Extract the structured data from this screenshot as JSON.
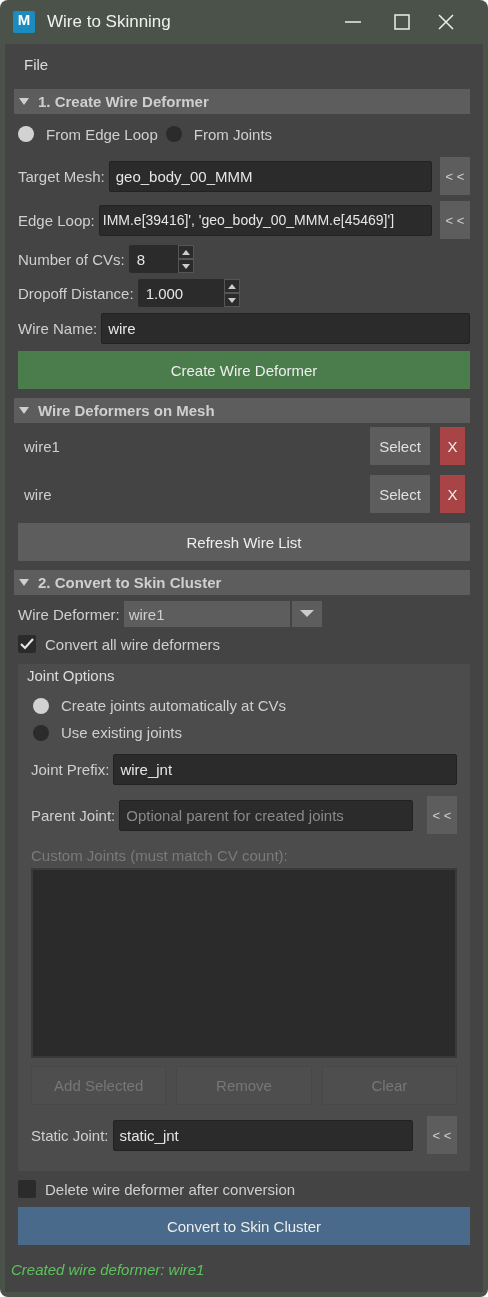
{
  "window": {
    "title": "Wire to Skinning",
    "icon_letter": "M"
  },
  "menu": [
    {
      "label": "File"
    }
  ],
  "create_section": {
    "title": "1. Create Wire Deformer",
    "expanded": true,
    "source_options": [
      {
        "label": "From Edge Loop",
        "selected": true
      },
      {
        "label": "From Joints",
        "selected": false
      }
    ],
    "target_mesh": {
      "label": "Target Mesh:",
      "value": "geo_body_00_MMM",
      "button": "< <"
    },
    "edge_loop": {
      "label": "Edge Loop:",
      "value": "IMM.e[39416]', 'geo_body_00_MMM.e[45469]']",
      "button": "< <"
    },
    "num_cvs": {
      "label": "Number of CVs:",
      "value": "8"
    },
    "dropoff": {
      "label": "Dropoff Distance:",
      "value": "1.000"
    },
    "wire_name": {
      "label": "Wire Name:",
      "value": "wire"
    },
    "create_button": "Create Wire Deformer"
  },
  "wire_list_section": {
    "title": "Wire Deformers on Mesh",
    "expanded": true,
    "items": [
      {
        "name": "wire1",
        "select_button": "Select",
        "delete_button": "X"
      },
      {
        "name": "wire",
        "select_button": "Select",
        "delete_button": "X"
      }
    ],
    "refresh_button": "Refresh Wire List"
  },
  "convert_section": {
    "title": "2. Convert to Skin Cluster",
    "expanded": true,
    "wire_deformer": {
      "label": "Wire Deformer:",
      "value": "wire1"
    },
    "convert_all": {
      "label": "Convert all wire deformers",
      "checked": true
    },
    "joint_options": {
      "title": "Joint Options",
      "modes": [
        {
          "label": "Create joints automatically at CVs",
          "selected": true
        },
        {
          "label": "Use existing joints",
          "selected": false
        }
      ],
      "joint_prefix": {
        "label": "Joint Prefix:",
        "value": "wire_jnt"
      },
      "parent_joint": {
        "label": "Parent Joint:",
        "placeholder": "Optional parent for created joints",
        "button": "< <"
      },
      "custom_joints": {
        "label": "Custom Joints (must match CV count):",
        "disabled": true
      },
      "list_buttons": [
        {
          "label": "Add Selected",
          "disabled": true
        },
        {
          "label": "Remove",
          "disabled": true
        },
        {
          "label": "Clear",
          "disabled": true
        }
      ],
      "static_joint": {
        "label": "Static Joint:",
        "value": "static_jnt",
        "button": "< <"
      }
    },
    "delete_after": {
      "label": "Delete wire deformer after conversion",
      "checked": false
    },
    "convert_button": "Convert to Skin Cluster"
  },
  "status": "Created wire deformer: wire1"
}
